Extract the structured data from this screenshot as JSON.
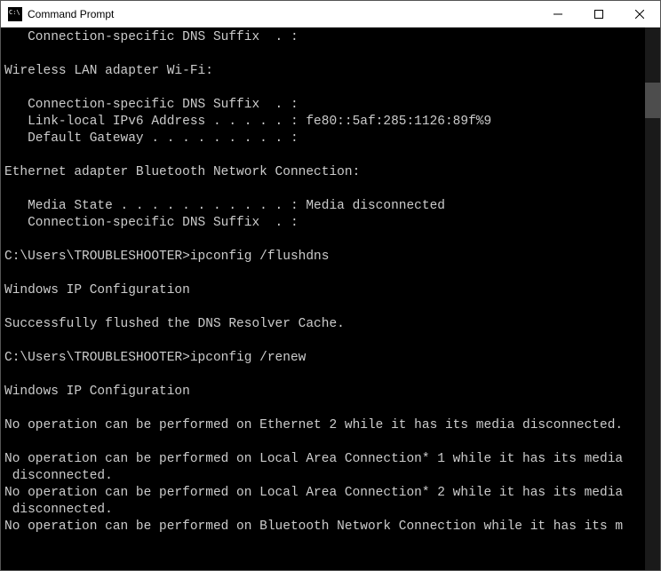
{
  "window": {
    "title": "Command Prompt"
  },
  "terminal": {
    "lines": [
      "   Connection-specific DNS Suffix  . :",
      "",
      "Wireless LAN adapter Wi-Fi:",
      "",
      "   Connection-specific DNS Suffix  . :",
      "   Link-local IPv6 Address . . . . . : fe80::5af:285:1126:89f%9",
      "   Default Gateway . . . . . . . . . :",
      "",
      "Ethernet adapter Bluetooth Network Connection:",
      "",
      "   Media State . . . . . . . . . . . : Media disconnected",
      "   Connection-specific DNS Suffix  . :",
      "",
      "C:\\Users\\TROUBLESHOOTER>ipconfig /flushdns",
      "",
      "Windows IP Configuration",
      "",
      "Successfully flushed the DNS Resolver Cache.",
      "",
      "C:\\Users\\TROUBLESHOOTER>ipconfig /renew",
      "",
      "Windows IP Configuration",
      "",
      "No operation can be performed on Ethernet 2 while it has its media disconnected.",
      "",
      "No operation can be performed on Local Area Connection* 1 while it has its media",
      " disconnected.",
      "No operation can be performed on Local Area Connection* 2 while it has its media",
      " disconnected.",
      "No operation can be performed on Bluetooth Network Connection while it has its m"
    ]
  }
}
